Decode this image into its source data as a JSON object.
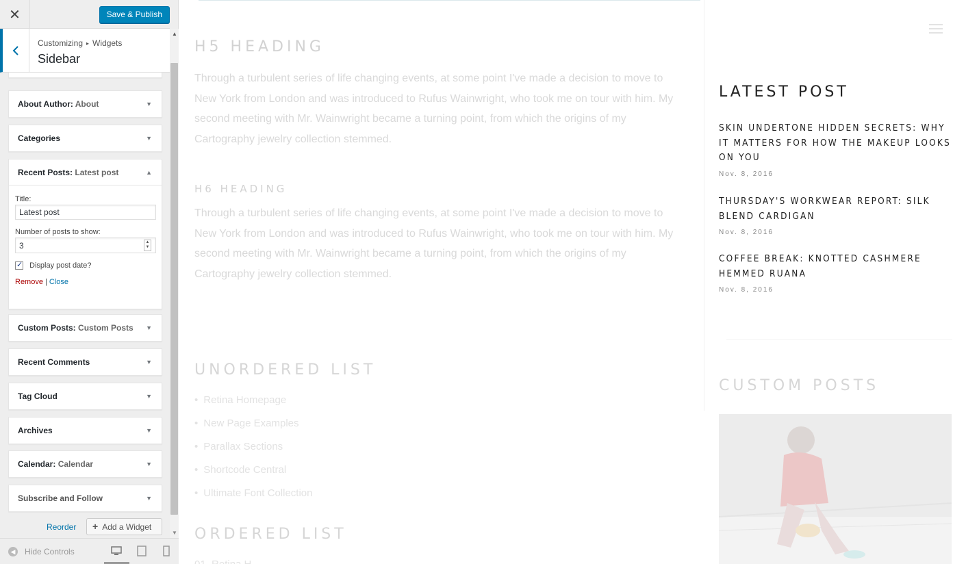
{
  "topbar": {
    "close_symbol": "✕",
    "save_label": "Save & Publish"
  },
  "section": {
    "breadcrumb_root": "Customizing",
    "breadcrumb_sep": "▸",
    "breadcrumb_child": "Widgets",
    "title": "Sidebar"
  },
  "widgets": [
    {
      "name": "About Author:",
      "instance": "About"
    },
    {
      "name": "Categories",
      "instance": ""
    },
    {
      "name": "Recent Posts:",
      "instance": "Latest post",
      "expanded": true
    },
    {
      "name": "Custom Posts:",
      "instance": "Custom Posts"
    },
    {
      "name": "Recent Comments",
      "instance": ""
    },
    {
      "name": "Tag Cloud",
      "instance": ""
    },
    {
      "name": "Archives",
      "instance": ""
    },
    {
      "name": "Calendar:",
      "instance": "Calendar"
    },
    {
      "name": "Subscribe and Follow",
      "instance": ""
    }
  ],
  "recent_posts_form": {
    "title_label": "Title:",
    "title_value": "Latest post",
    "number_label": "Number of posts to show:",
    "number_value": "3",
    "display_date_label": "Display post date?",
    "display_date_checked": true,
    "remove_label": "Remove",
    "separator": "|",
    "close_label": "Close"
  },
  "panel_actions": {
    "reorder_label": "Reorder",
    "add_widget_label": "Add a Widget"
  },
  "footer": {
    "hide_controls_label": "Hide Controls"
  },
  "preview": {
    "h5_heading": "H5 HEADING",
    "h6_heading": "H6 HEADING",
    "paragraph": "Through a turbulent series of life changing events, at some point I've made a decision to move to New York from London and was introduced to Rufus Wainwright, who took me on tour with him. My second meeting with Mr. Wainwright became a turning point, from which the origins of my Cartography jewelry collection stemmed.",
    "unordered_heading": "UNORDERED LIST",
    "unordered_items": [
      "Retina Homepage",
      "New Page Examples",
      "Parallax Sections",
      "Shortcode Central",
      "Ultimate Font Collection"
    ],
    "ordered_heading": "ORDERED LIST",
    "ordered_first": "01. Retina H"
  },
  "sidebar": {
    "latest_title": "LATEST POST",
    "posts": [
      {
        "title": "SKIN UNDERTONE HIDDEN SECRETS: WHY IT MATTERS FOR HOW THE MAKEUP LOOKS ON YOU",
        "date": "Nov. 8, 2016"
      },
      {
        "title": "THURSDAY'S WORKWEAR REPORT: SILK BLEND CARDIGAN",
        "date": "Nov. 8, 2016"
      },
      {
        "title": "COFFEE BREAK: KNOTTED CASHMERE HEMMED RUANA",
        "date": "Nov. 8, 2016"
      }
    ],
    "custom_title": "CUSTOM POSTS"
  },
  "colors": {
    "accent": "#0085ba",
    "link": "#0073aa",
    "remove": "#aa0000"
  }
}
